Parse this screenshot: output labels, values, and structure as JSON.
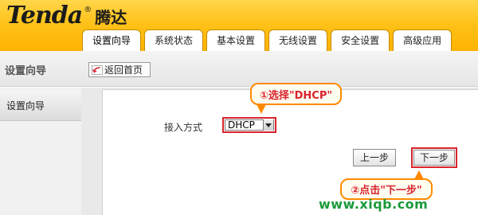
{
  "brand": {
    "logo_text": "Tenda",
    "logo_mark": "®",
    "logo_cn": "腾达"
  },
  "nav": {
    "tabs": [
      {
        "label": "设置向导",
        "active": true
      },
      {
        "label": "系统状态",
        "active": false
      },
      {
        "label": "基本设置",
        "active": false
      },
      {
        "label": "无线设置",
        "active": false
      },
      {
        "label": "安全设置",
        "active": false
      },
      {
        "label": "高级应用",
        "active": false
      }
    ]
  },
  "subheader": {
    "section_title": "设置向导",
    "home_button": "返回首页"
  },
  "sidebar": {
    "items": [
      {
        "label": "设置向导"
      }
    ]
  },
  "form": {
    "access_label": "接入方式",
    "access_value": "DHCP",
    "prev_button": "上一步",
    "next_button": "下一步"
  },
  "annotations": {
    "callout_1": "①选择\"DHCP\"",
    "callout_2": "②点击\"下一步\""
  },
  "watermark": "www.xiqb.com",
  "colors": {
    "header": "#ffc21a",
    "highlight_border": "#d9232d",
    "callout_border": "#ff8a00",
    "watermark": "#1a9a3b"
  }
}
